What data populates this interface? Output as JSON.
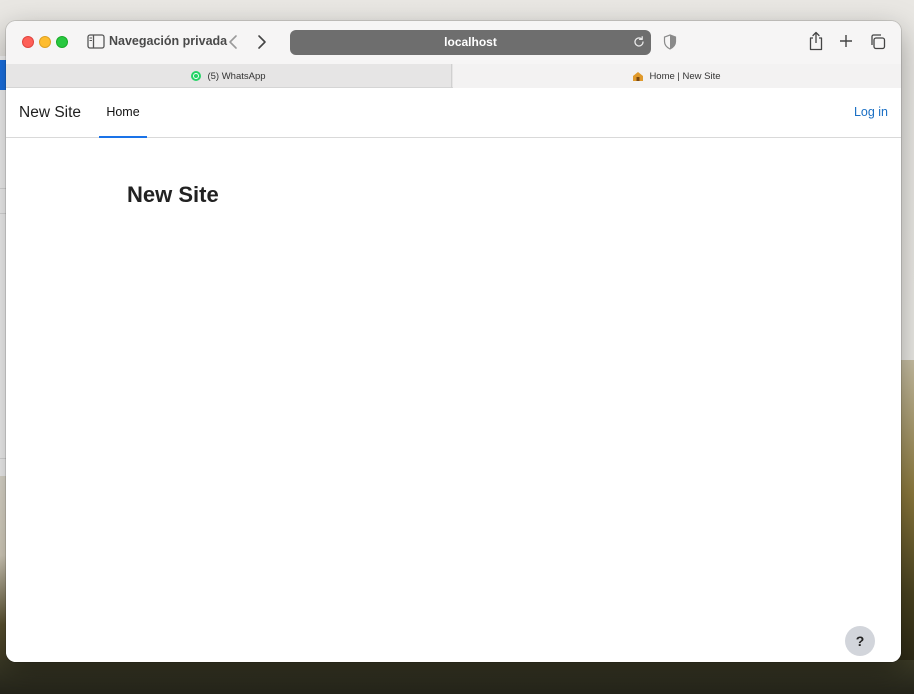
{
  "browser": {
    "private_label": "Navegación privada",
    "address_text": "localhost",
    "tabs": [
      {
        "label": "(5) WhatsApp",
        "favicon": "whatsapp-icon",
        "active": false
      },
      {
        "label": "Home | New Site",
        "favicon": "site-favicon-icon",
        "active": true
      }
    ]
  },
  "site": {
    "brand": "New Site",
    "nav_items": [
      {
        "label": "Home",
        "active": true
      }
    ],
    "login_label": "Log in",
    "page_title": "New Site",
    "help_label": "?"
  },
  "colors": {
    "accent": "#1a73e8",
    "link": "#1a6fc4",
    "traffic_red": "#fe5f57",
    "traffic_yellow": "#febc2e",
    "traffic_green": "#28c840"
  }
}
